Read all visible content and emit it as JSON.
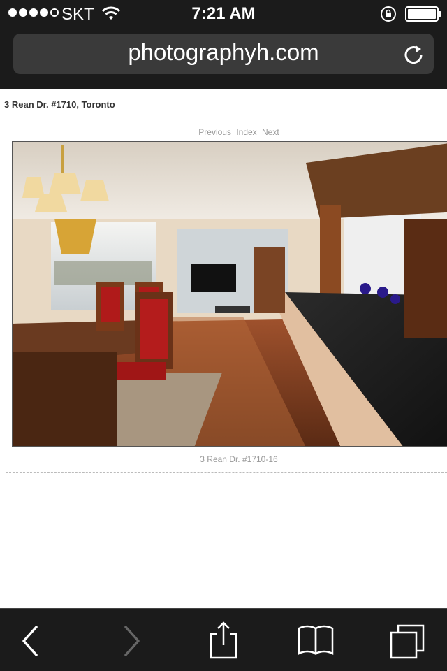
{
  "status": {
    "carrier": "SKT",
    "time": "7:21 AM"
  },
  "browser": {
    "url": "photographyh.com"
  },
  "page": {
    "heading": "3 Rean Dr. #1710, Toronto",
    "nav": {
      "previous": "Previous",
      "index": "Index",
      "next": "Next"
    },
    "caption": "3 Rean Dr. #1710-16"
  },
  "icons": {
    "status": [
      "signal-dots",
      "wifi-icon",
      "rotation-lock-icon",
      "battery-icon"
    ],
    "toolbar": [
      "back-icon",
      "forward-icon",
      "share-icon",
      "bookmarks-icon",
      "tabs-icon"
    ]
  }
}
